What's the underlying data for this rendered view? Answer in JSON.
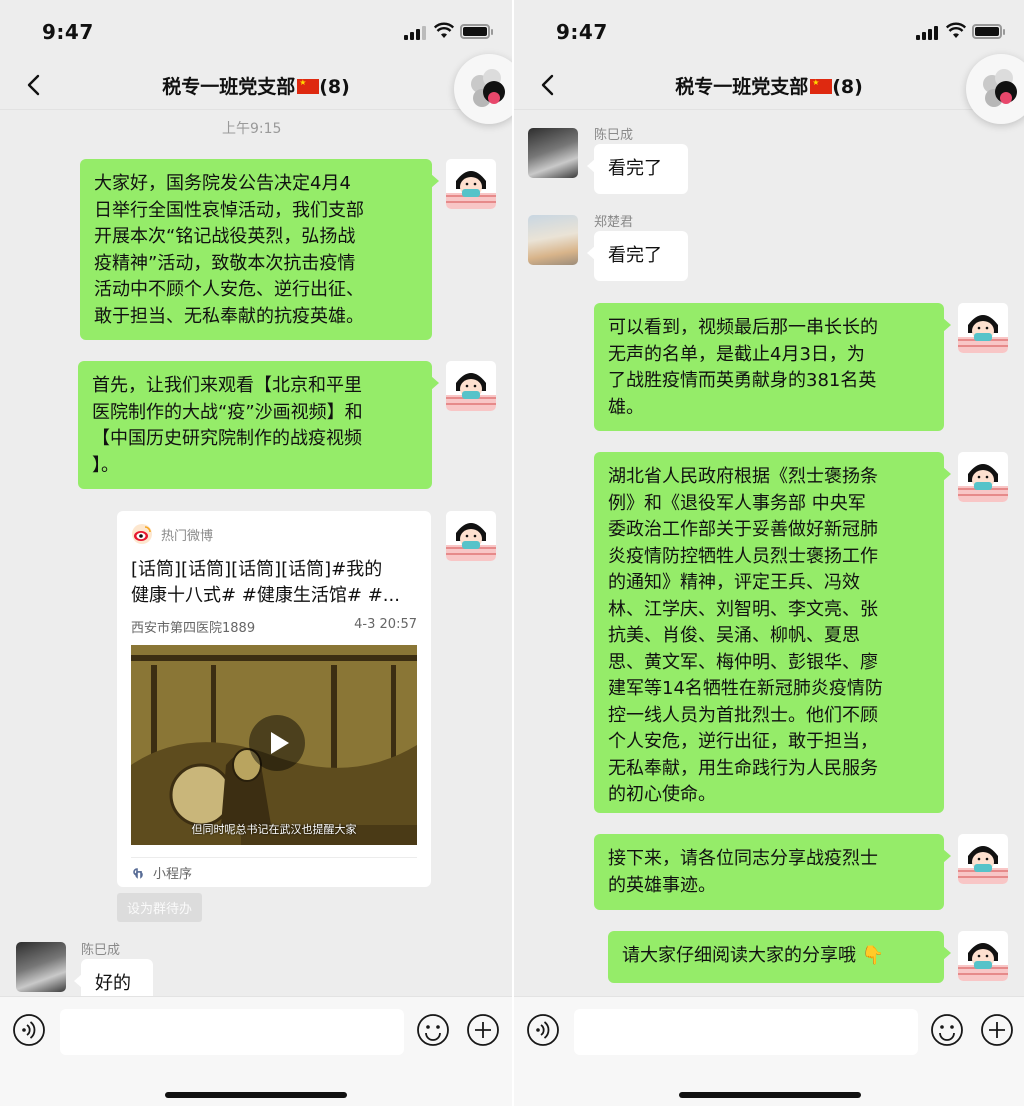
{
  "status": {
    "time": "9:47"
  },
  "chat": {
    "title": "税专一班党支部",
    "member_count": "(8)"
  },
  "left": {
    "timestamp": "上午9:15",
    "msg1": [
      "大家好，国务院发公告决定4月4",
      "日举行全国性哀悼活动，我们支部",
      "开展本次“铭记战役英烈，弘扬战",
      "疫精神”活动，致敬本次抗击疫情",
      "活动中不顾个人安危、逆行出征、",
      "敢于担当、无私奉献的抗疫英雄。"
    ],
    "msg2": [
      "首先，让我们来观看【北京和平里",
      "医院制作的大战“疫”沙画视频】和",
      "【中国历史研究院制作的战疫视频",
      "】。"
    ],
    "card": {
      "brand": "热门微博",
      "title_lines": [
        "[话筒][话筒][话筒][话筒]#我的",
        "健康十八式# #健康生活馆# #..."
      ],
      "source": "西安市第四医院1889",
      "date": "4-3 20:57",
      "video_caption": "但同时呢总书记在武汉也提醒大家",
      "footer": "小程序"
    },
    "todo_tag": "设为群待办",
    "last_sender": "陈巳成",
    "last_msg": "好的"
  },
  "right": {
    "sender1": "陈巳成",
    "msg1": "看完了",
    "sender2": "郑楚君",
    "msg2": "看完了",
    "msg3": [
      "可以看到，视频最后那一串长长的",
      "无声的名单，是截止4月3日，为",
      "了战胜疫情而英勇献身的381名英",
      "雄。"
    ],
    "msg4": [
      "湖北省人民政府根据《烈士褒扬条",
      "例》和《退役军人事务部 中央军",
      "委政治工作部关于妥善做好新冠肺",
      "炎疫情防控牺牲人员烈士褒扬工作",
      "的通知》精神，评定王兵、冯效",
      "林、江学庆、刘智明、李文亮、张",
      "抗美、肖俊、吴涌、柳帆、夏思",
      "思、黄文军、梅仲明、彭银华、廖",
      "建军等14名牺牲在新冠肺炎疫情防",
      "控一线人员为首批烈士。他们不顾",
      "个人安危，逆行出征，敢于担当，",
      "无私奉献，用生命践行为人民服务",
      "的初心使命。"
    ],
    "msg5": [
      "接下来，请各位同志分享战疫烈士",
      "的英雄事迹。"
    ],
    "msg6": "请大家仔细阅读大家的分享哦",
    "msg6_emoji": "👇"
  },
  "icons": [
    "back-chevron-icon",
    "signal-icon",
    "wifi-icon",
    "battery-icon",
    "mini-program-icon",
    "weibo-logo-icon",
    "play-icon",
    "voice-icon",
    "emoji-icon",
    "plus-icon"
  ],
  "colors": {
    "my_bubble": "#95ec69",
    "other_bubble": "#ffffff",
    "background": "#ededed"
  }
}
